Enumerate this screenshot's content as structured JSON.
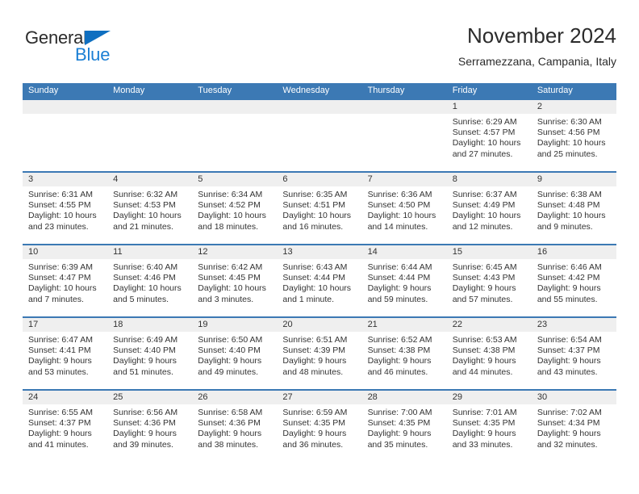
{
  "logo": {
    "word_one": "General",
    "word_two": "Blue",
    "triangle_icon": "triangle-right-icon",
    "brand_blue": "#1b7fd4",
    "brand_dark": "#2b2b2b"
  },
  "header": {
    "month_title": "November 2024",
    "location": "Serramezzana, Campania, Italy"
  },
  "colors": {
    "header_blue": "#3c79b4",
    "daynum_band": "#efefef",
    "text": "#333333"
  },
  "calendar": {
    "weekdays": [
      "Sunday",
      "Monday",
      "Tuesday",
      "Wednesday",
      "Thursday",
      "Friday",
      "Saturday"
    ],
    "weeks": [
      [
        {
          "day": "",
          "sunrise": "",
          "sunset": "",
          "daylight_line1": "",
          "daylight_line2": ""
        },
        {
          "day": "",
          "sunrise": "",
          "sunset": "",
          "daylight_line1": "",
          "daylight_line2": ""
        },
        {
          "day": "",
          "sunrise": "",
          "sunset": "",
          "daylight_line1": "",
          "daylight_line2": ""
        },
        {
          "day": "",
          "sunrise": "",
          "sunset": "",
          "daylight_line1": "",
          "daylight_line2": ""
        },
        {
          "day": "",
          "sunrise": "",
          "sunset": "",
          "daylight_line1": "",
          "daylight_line2": ""
        },
        {
          "day": "1",
          "sunrise": "Sunrise: 6:29 AM",
          "sunset": "Sunset: 4:57 PM",
          "daylight_line1": "Daylight: 10 hours",
          "daylight_line2": "and 27 minutes."
        },
        {
          "day": "2",
          "sunrise": "Sunrise: 6:30 AM",
          "sunset": "Sunset: 4:56 PM",
          "daylight_line1": "Daylight: 10 hours",
          "daylight_line2": "and 25 minutes."
        }
      ],
      [
        {
          "day": "3",
          "sunrise": "Sunrise: 6:31 AM",
          "sunset": "Sunset: 4:55 PM",
          "daylight_line1": "Daylight: 10 hours",
          "daylight_line2": "and 23 minutes."
        },
        {
          "day": "4",
          "sunrise": "Sunrise: 6:32 AM",
          "sunset": "Sunset: 4:53 PM",
          "daylight_line1": "Daylight: 10 hours",
          "daylight_line2": "and 21 minutes."
        },
        {
          "day": "5",
          "sunrise": "Sunrise: 6:34 AM",
          "sunset": "Sunset: 4:52 PM",
          "daylight_line1": "Daylight: 10 hours",
          "daylight_line2": "and 18 minutes."
        },
        {
          "day": "6",
          "sunrise": "Sunrise: 6:35 AM",
          "sunset": "Sunset: 4:51 PM",
          "daylight_line1": "Daylight: 10 hours",
          "daylight_line2": "and 16 minutes."
        },
        {
          "day": "7",
          "sunrise": "Sunrise: 6:36 AM",
          "sunset": "Sunset: 4:50 PM",
          "daylight_line1": "Daylight: 10 hours",
          "daylight_line2": "and 14 minutes."
        },
        {
          "day": "8",
          "sunrise": "Sunrise: 6:37 AM",
          "sunset": "Sunset: 4:49 PM",
          "daylight_line1": "Daylight: 10 hours",
          "daylight_line2": "and 12 minutes."
        },
        {
          "day": "9",
          "sunrise": "Sunrise: 6:38 AM",
          "sunset": "Sunset: 4:48 PM",
          "daylight_line1": "Daylight: 10 hours",
          "daylight_line2": "and 9 minutes."
        }
      ],
      [
        {
          "day": "10",
          "sunrise": "Sunrise: 6:39 AM",
          "sunset": "Sunset: 4:47 PM",
          "daylight_line1": "Daylight: 10 hours",
          "daylight_line2": "and 7 minutes."
        },
        {
          "day": "11",
          "sunrise": "Sunrise: 6:40 AM",
          "sunset": "Sunset: 4:46 PM",
          "daylight_line1": "Daylight: 10 hours",
          "daylight_line2": "and 5 minutes."
        },
        {
          "day": "12",
          "sunrise": "Sunrise: 6:42 AM",
          "sunset": "Sunset: 4:45 PM",
          "daylight_line1": "Daylight: 10 hours",
          "daylight_line2": "and 3 minutes."
        },
        {
          "day": "13",
          "sunrise": "Sunrise: 6:43 AM",
          "sunset": "Sunset: 4:44 PM",
          "daylight_line1": "Daylight: 10 hours",
          "daylight_line2": "and 1 minute."
        },
        {
          "day": "14",
          "sunrise": "Sunrise: 6:44 AM",
          "sunset": "Sunset: 4:44 PM",
          "daylight_line1": "Daylight: 9 hours",
          "daylight_line2": "and 59 minutes."
        },
        {
          "day": "15",
          "sunrise": "Sunrise: 6:45 AM",
          "sunset": "Sunset: 4:43 PM",
          "daylight_line1": "Daylight: 9 hours",
          "daylight_line2": "and 57 minutes."
        },
        {
          "day": "16",
          "sunrise": "Sunrise: 6:46 AM",
          "sunset": "Sunset: 4:42 PM",
          "daylight_line1": "Daylight: 9 hours",
          "daylight_line2": "and 55 minutes."
        }
      ],
      [
        {
          "day": "17",
          "sunrise": "Sunrise: 6:47 AM",
          "sunset": "Sunset: 4:41 PM",
          "daylight_line1": "Daylight: 9 hours",
          "daylight_line2": "and 53 minutes."
        },
        {
          "day": "18",
          "sunrise": "Sunrise: 6:49 AM",
          "sunset": "Sunset: 4:40 PM",
          "daylight_line1": "Daylight: 9 hours",
          "daylight_line2": "and 51 minutes."
        },
        {
          "day": "19",
          "sunrise": "Sunrise: 6:50 AM",
          "sunset": "Sunset: 4:40 PM",
          "daylight_line1": "Daylight: 9 hours",
          "daylight_line2": "and 49 minutes."
        },
        {
          "day": "20",
          "sunrise": "Sunrise: 6:51 AM",
          "sunset": "Sunset: 4:39 PM",
          "daylight_line1": "Daylight: 9 hours",
          "daylight_line2": "and 48 minutes."
        },
        {
          "day": "21",
          "sunrise": "Sunrise: 6:52 AM",
          "sunset": "Sunset: 4:38 PM",
          "daylight_line1": "Daylight: 9 hours",
          "daylight_line2": "and 46 minutes."
        },
        {
          "day": "22",
          "sunrise": "Sunrise: 6:53 AM",
          "sunset": "Sunset: 4:38 PM",
          "daylight_line1": "Daylight: 9 hours",
          "daylight_line2": "and 44 minutes."
        },
        {
          "day": "23",
          "sunrise": "Sunrise: 6:54 AM",
          "sunset": "Sunset: 4:37 PM",
          "daylight_line1": "Daylight: 9 hours",
          "daylight_line2": "and 43 minutes."
        }
      ],
      [
        {
          "day": "24",
          "sunrise": "Sunrise: 6:55 AM",
          "sunset": "Sunset: 4:37 PM",
          "daylight_line1": "Daylight: 9 hours",
          "daylight_line2": "and 41 minutes."
        },
        {
          "day": "25",
          "sunrise": "Sunrise: 6:56 AM",
          "sunset": "Sunset: 4:36 PM",
          "daylight_line1": "Daylight: 9 hours",
          "daylight_line2": "and 39 minutes."
        },
        {
          "day": "26",
          "sunrise": "Sunrise: 6:58 AM",
          "sunset": "Sunset: 4:36 PM",
          "daylight_line1": "Daylight: 9 hours",
          "daylight_line2": "and 38 minutes."
        },
        {
          "day": "27",
          "sunrise": "Sunrise: 6:59 AM",
          "sunset": "Sunset: 4:35 PM",
          "daylight_line1": "Daylight: 9 hours",
          "daylight_line2": "and 36 minutes."
        },
        {
          "day": "28",
          "sunrise": "Sunrise: 7:00 AM",
          "sunset": "Sunset: 4:35 PM",
          "daylight_line1": "Daylight: 9 hours",
          "daylight_line2": "and 35 minutes."
        },
        {
          "day": "29",
          "sunrise": "Sunrise: 7:01 AM",
          "sunset": "Sunset: 4:35 PM",
          "daylight_line1": "Daylight: 9 hours",
          "daylight_line2": "and 33 minutes."
        },
        {
          "day": "30",
          "sunrise": "Sunrise: 7:02 AM",
          "sunset": "Sunset: 4:34 PM",
          "daylight_line1": "Daylight: 9 hours",
          "daylight_line2": "and 32 minutes."
        }
      ]
    ]
  }
}
